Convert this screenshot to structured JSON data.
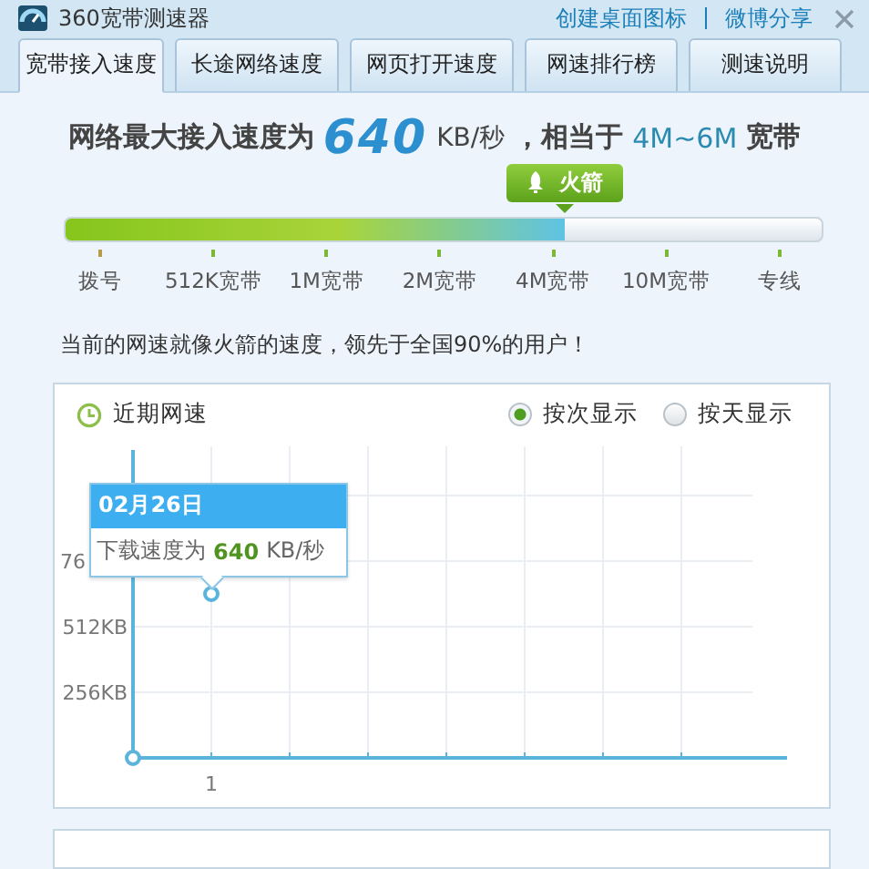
{
  "window": {
    "title": "360宽带测速器",
    "links": [
      "创建桌面图标",
      "微博分享"
    ]
  },
  "tabs": [
    {
      "label": "宽带接入速度",
      "selected": true
    },
    {
      "label": "长途网络速度",
      "selected": false
    },
    {
      "label": "网页打开速度",
      "selected": false
    },
    {
      "label": "网速排行榜",
      "selected": false
    },
    {
      "label": "测速说明",
      "selected": false
    }
  ],
  "headline": {
    "prefix": "网络最大接入速度为",
    "speed": "640",
    "unit": "KB/秒",
    "middle": "，相当于",
    "range": "4M~6M",
    "suffix": "宽带"
  },
  "speed_meter": {
    "badge": "火箭",
    "level": 0.66,
    "ticks": [
      "拨号",
      "512K宽带",
      "1M宽带",
      "2M宽带",
      "4M宽带",
      "10M宽带",
      "专线"
    ]
  },
  "summary": "当前的网速就像火箭的速度，领先于全国90%的用户！",
  "recent_speed": {
    "title": "近期网速",
    "view_options": [
      {
        "label": "按次显示",
        "selected": true
      },
      {
        "label": "按天显示",
        "selected": false
      }
    ],
    "tooltip": {
      "date": "02月26日",
      "prefix": "下载速度为",
      "value": "640",
      "unit": "KB/秒"
    },
    "cut_tick_label": "76",
    "y_axis_labels": [
      "512KB",
      "256KB"
    ],
    "x_axis_labels": [
      "1"
    ]
  }
}
